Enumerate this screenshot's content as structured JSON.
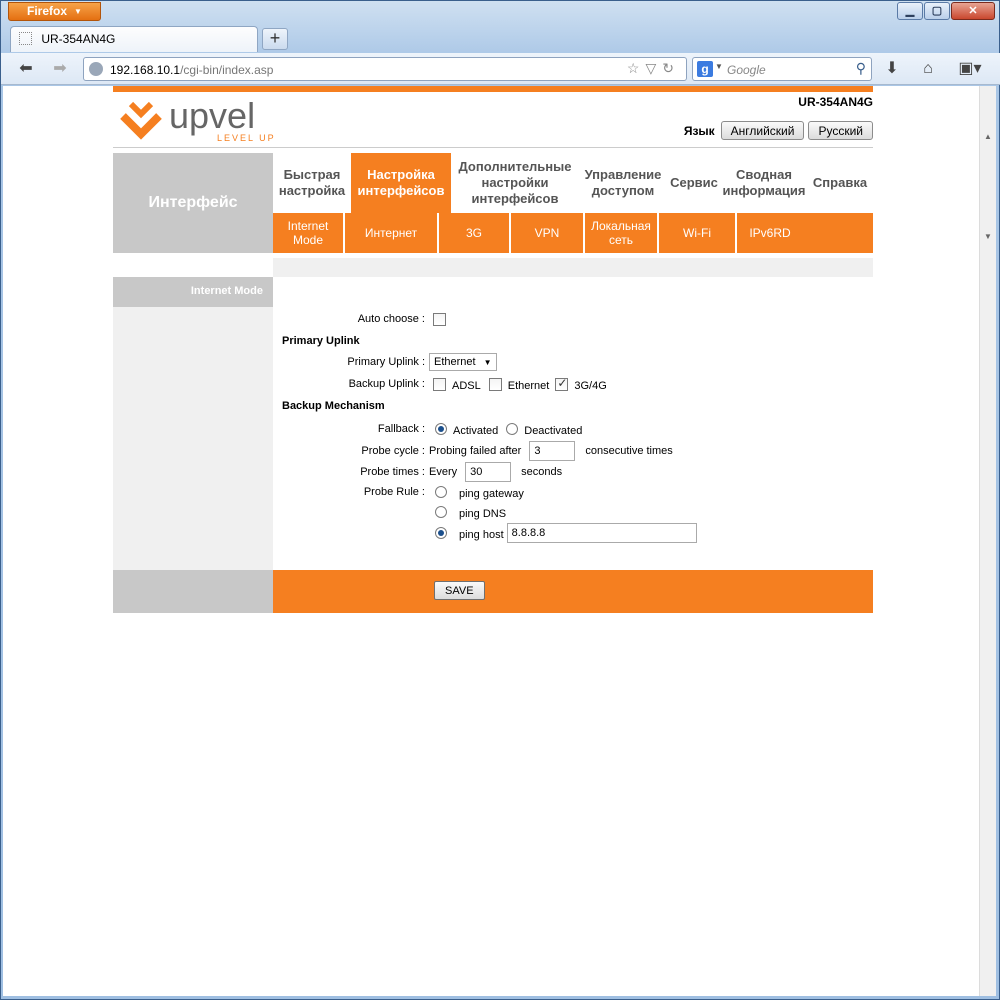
{
  "browser": {
    "app_button": "Firefox",
    "tab_title": "UR-354AN4G",
    "url_host": "192.168.10.1",
    "url_path": "/cgi-bin/index.asp",
    "search_placeholder": "Google"
  },
  "header": {
    "model": "UR-354AN4G",
    "lang_label": "Язык",
    "lang_english": "Английский",
    "lang_russian": "Русский",
    "logo_text": "upvel",
    "logo_tagline": "LEVEL UP"
  },
  "side_title": "Интерфейс",
  "main_menu": [
    {
      "label": "Быстрая\nнастройка"
    },
    {
      "label": "Настройка\nинтерфейсов"
    },
    {
      "label": "Дополнительные\nнастройки\nинтерфейсов"
    },
    {
      "label": "Управление\nдоступом"
    },
    {
      "label": "Сервис"
    },
    {
      "label": "Сводная\nинформация"
    },
    {
      "label": "Справка"
    }
  ],
  "sub_menu": [
    {
      "label": "Internet\nMode"
    },
    {
      "label": "Интернет"
    },
    {
      "label": "3G"
    },
    {
      "label": "VPN"
    },
    {
      "label": "Локальная\nсеть"
    },
    {
      "label": "Wi-Fi"
    },
    {
      "label": "IPv6RD"
    }
  ],
  "section_label": "Internet Mode",
  "form": {
    "auto_choose_label": "Auto choose :",
    "primary_uplink_heading": "Primary Uplink",
    "primary_uplink_label": "Primary Uplink :",
    "primary_uplink_value": "Ethernet",
    "backup_uplink_label": "Backup Uplink :",
    "backup_adsl": "ADSL",
    "backup_ethernet": "Ethernet",
    "backup_3g4g": "3G/4G",
    "backup_mechanism_heading": "Backup Mechanism",
    "fallback_label": "Fallback :",
    "fallback_activated": "Activated",
    "fallback_deactivated": "Deactivated",
    "probe_cycle_label": "Probe cycle :",
    "probe_cycle_prefix": "Probing failed after",
    "probe_cycle_value": "3",
    "probe_cycle_suffix": "consecutive times",
    "probe_times_label": "Probe times :",
    "probe_times_prefix": "Every",
    "probe_times_value": "30",
    "probe_times_suffix": "seconds",
    "probe_rule_label": "Probe Rule :",
    "rule_gateway": "ping gateway",
    "rule_dns": "ping DNS",
    "rule_host": "ping host",
    "rule_host_value": "8.8.8.8"
  },
  "save_label": "SAVE",
  "colors": {
    "accent": "#f57f20",
    "side_gray": "#c8c8c8"
  }
}
